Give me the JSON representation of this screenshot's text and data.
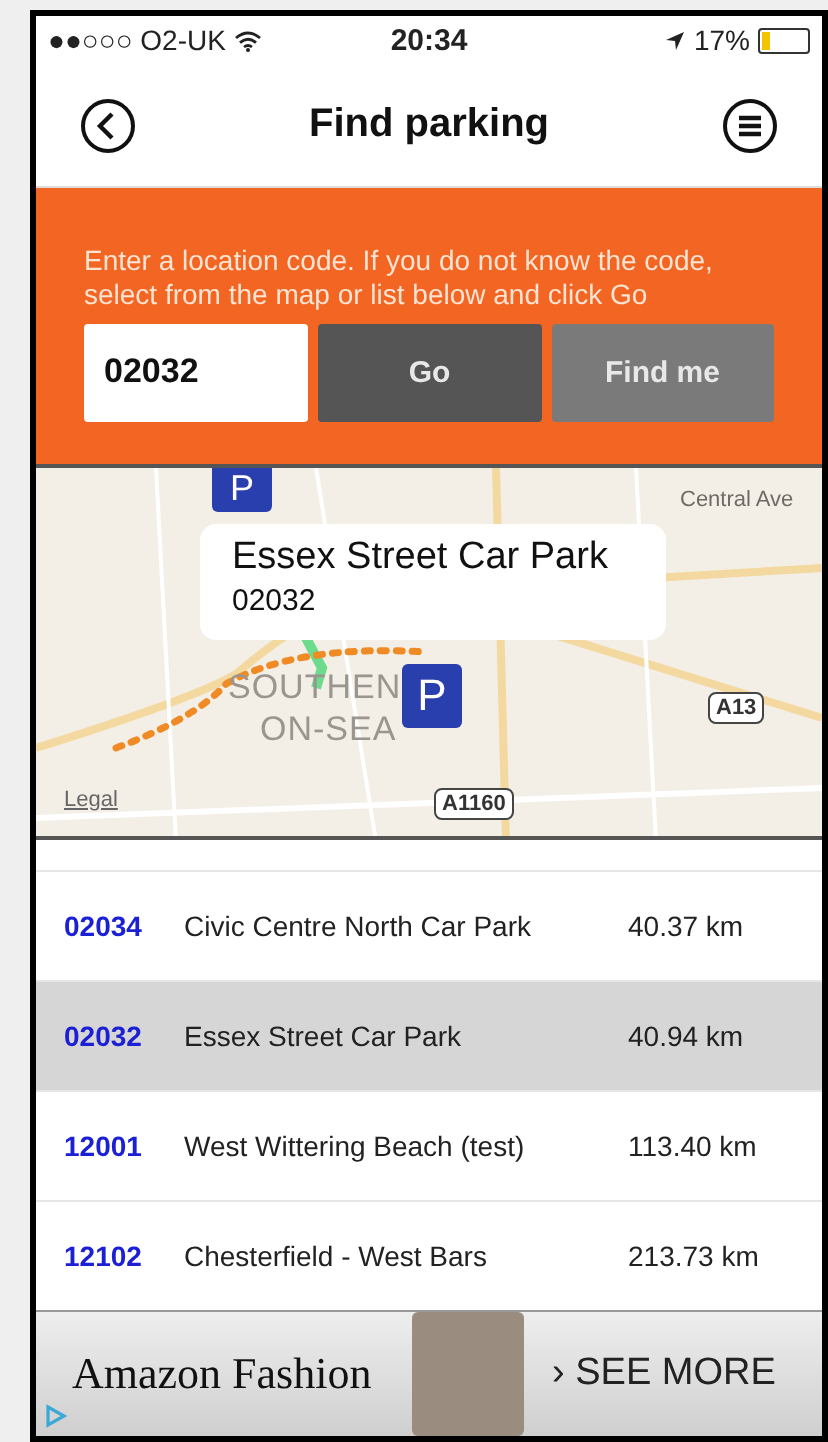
{
  "status_bar": {
    "carrier": "●●○○○ O2-UK",
    "time": "20:34",
    "battery": "17%"
  },
  "nav": {
    "title": "Find parking"
  },
  "search": {
    "instructions": "Enter a location code. If you do not know the code, select from the map or list below and click Go",
    "code_value": "02032",
    "go_button": "Go",
    "find_me_button": "Find me"
  },
  "map": {
    "labels": [
      {
        "text": "Central Ave",
        "kind": "street"
      },
      {
        "text": "SOUTHEN",
        "kind": "town"
      },
      {
        "text": "ON-SEA",
        "kind": "town"
      },
      {
        "text": "A13",
        "kind": "road"
      },
      {
        "text": "Legal",
        "kind": "legal"
      },
      {
        "text": "A1160",
        "kind": "road"
      }
    ],
    "marker": "P",
    "top_marker": "P",
    "callout": {
      "title": "Essex Street Car Park",
      "code": "02032"
    }
  },
  "car_parks": [
    {
      "code": "02034",
      "name": "Civic Centre North Car Park",
      "distance": "40.37 km",
      "selected": false
    },
    {
      "code": "02032",
      "name": "Essex Street Car Park",
      "distance": "40.94 km",
      "selected": true
    },
    {
      "code": "12001",
      "name": "West Wittering Beach (test)",
      "distance": "113.40 km",
      "selected": false
    },
    {
      "code": "12102",
      "name": "Chesterfield - West Bars",
      "distance": "213.73 km",
      "selected": false
    }
  ],
  "ad": {
    "brand": "Amazon Fashion",
    "cta": "› SEE MORE"
  }
}
